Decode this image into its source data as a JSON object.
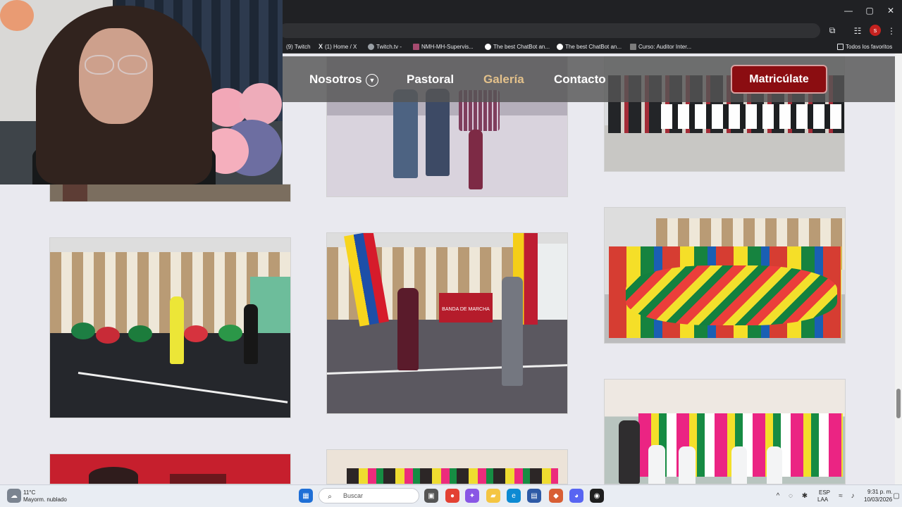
{
  "browser": {
    "bookmarks": [
      {
        "label": "(9) Twitch"
      },
      {
        "label": "(1) Home / X"
      },
      {
        "label": "Twitch.tv -"
      },
      {
        "label": "NMH-MH-Supervis..."
      },
      {
        "label": "The best ChatBot an..."
      },
      {
        "label": "The best ChatBot an..."
      },
      {
        "label": "Curso: Auditor Inter..."
      }
    ],
    "all_bookmarks": "Todos los favoritos",
    "profile_initial": "s"
  },
  "nav": {
    "items": [
      {
        "label": "Nosotros"
      },
      {
        "label": "Pastoral"
      },
      {
        "label": "Galería"
      },
      {
        "label": "Contacto"
      }
    ],
    "cta": "Matricúlate"
  },
  "gallery": {
    "banner_text": "BANDA DE MARCHA"
  },
  "taskbar": {
    "weather_temp": "11°C",
    "weather_desc": "Mayorm. nublado",
    "search_placeholder": "Buscar",
    "language_top": "ESP",
    "language_bottom": "LAA",
    "time": "9:31 p. m.",
    "date": "10/03/2026"
  }
}
